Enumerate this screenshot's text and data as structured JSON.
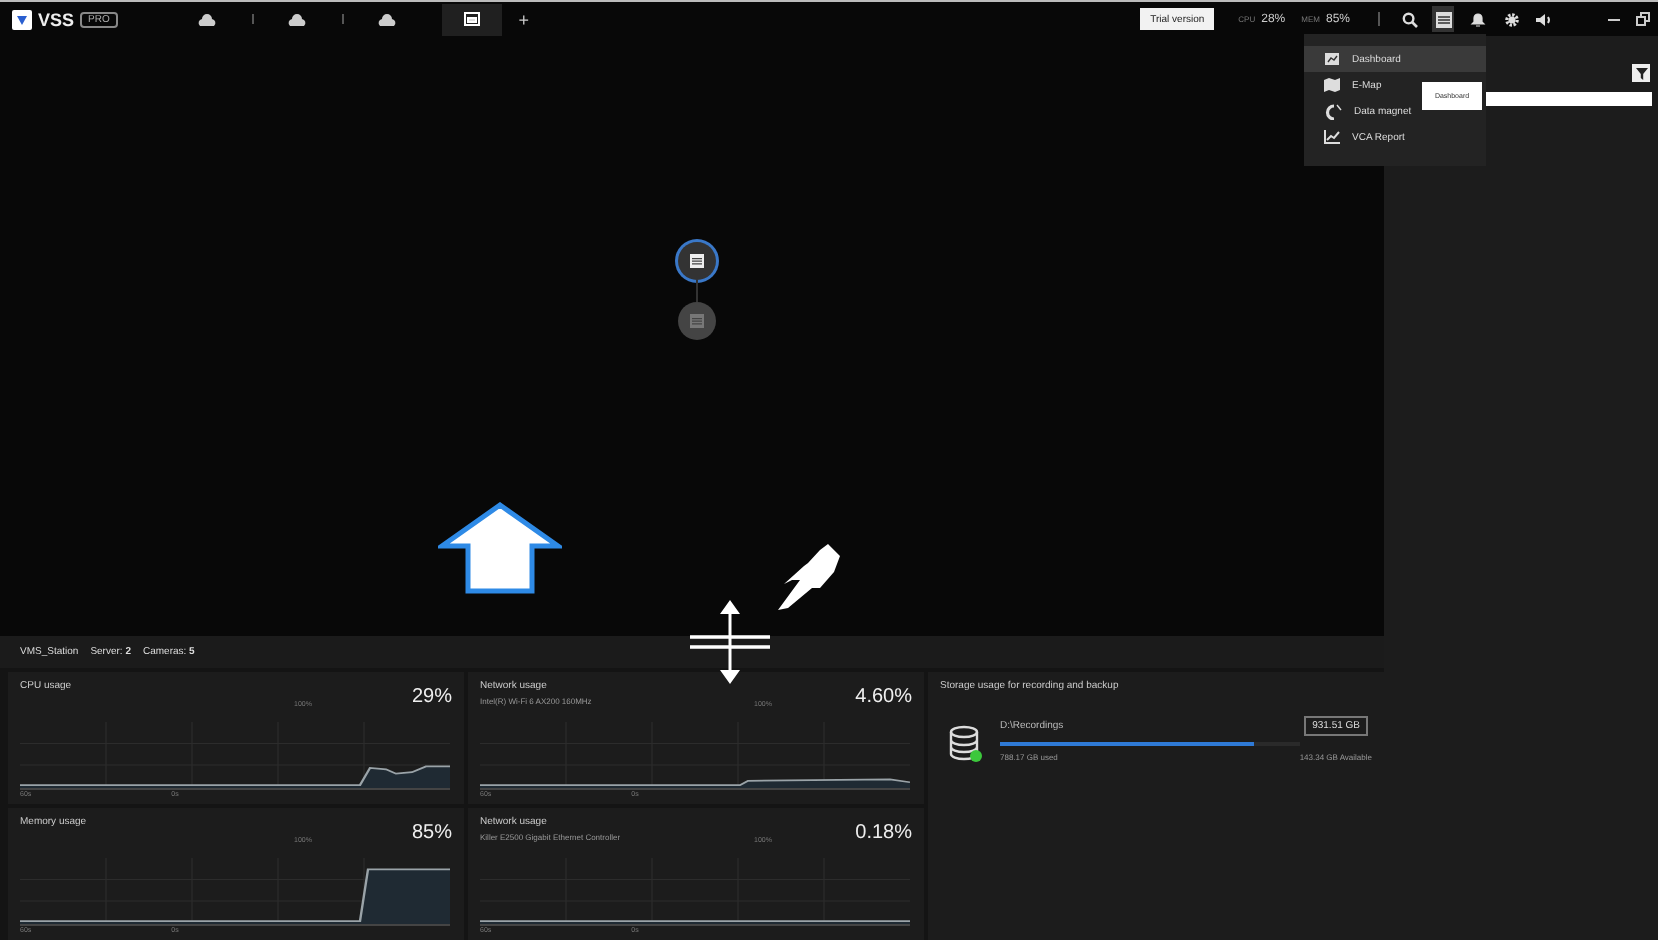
{
  "top_bar": {
    "logo": "VSS",
    "edition": "PRO",
    "tabs": [
      {
        "kind": "view",
        "selected": false
      },
      {
        "kind": "view",
        "selected": false
      },
      {
        "kind": "view",
        "selected": false
      },
      {
        "kind": "dashboard",
        "selected": true
      }
    ],
    "add_tab": "+",
    "trial_button": "Trial version",
    "cpu_label": "CPU",
    "cpu_value": "28%",
    "mem_label": "MEM",
    "mem_value": "85%",
    "tools": [
      {
        "kind": "search",
        "selected": false
      },
      {
        "kind": "dashboard",
        "selected": true
      },
      {
        "kind": "bell",
        "selected": false
      },
      {
        "kind": "gear",
        "selected": false
      },
      {
        "kind": "volume",
        "selected": false
      }
    ]
  },
  "menu": {
    "items": [
      {
        "kind": "dashboard",
        "label": "Dashboard",
        "selected": true
      },
      {
        "kind": "emap",
        "label": "E-Map",
        "selected": false
      },
      {
        "kind": "magnet",
        "label": "Data magnet",
        "selected": false
      },
      {
        "kind": "report",
        "label": "VCA Report",
        "selected": false
      }
    ],
    "tooltip": "Dashboard"
  },
  "view_nodes": [
    {
      "selected": true
    },
    {
      "selected": false
    }
  ],
  "dashboard": {
    "station": "VMS_Station",
    "server": "Server: **2**",
    "cameras": "Cameras: **5**",
    "charts": [
      {
        "kind": "cpu",
        "title": "CPU usage",
        "value": "29%",
        "top_label": "100%",
        "left_label": "60s",
        "mid_label": "0s"
      },
      {
        "kind": "net1",
        "title": "Network usage",
        "subtitle": "Intel(R) Wi-Fi 6 AX200 160MHz",
        "value": "4.60%",
        "top_label": "100%",
        "left_label": "60s",
        "mid_label": "0s"
      },
      {
        "kind": "mem",
        "title": "Memory usage",
        "value": "85%",
        "top_label": "100%",
        "left_label": "60s",
        "mid_label": "0s"
      },
      {
        "kind": "net2",
        "title": "Network usage",
        "subtitle": "Killer E2500 Gigabit Ethernet Controller",
        "value": "0.18%",
        "top_label": "100%",
        "left_label": "60s",
        "mid_label": "0s"
      }
    ],
    "storage": {
      "title": "Storage usage for recording and backup",
      "drive": "D:\\Recordings",
      "capacity": "931.51 GB",
      "level": 0.846,
      "used": "788.17 GB used",
      "available": "143.34 GB Available",
      "online": true
    }
  }
}
